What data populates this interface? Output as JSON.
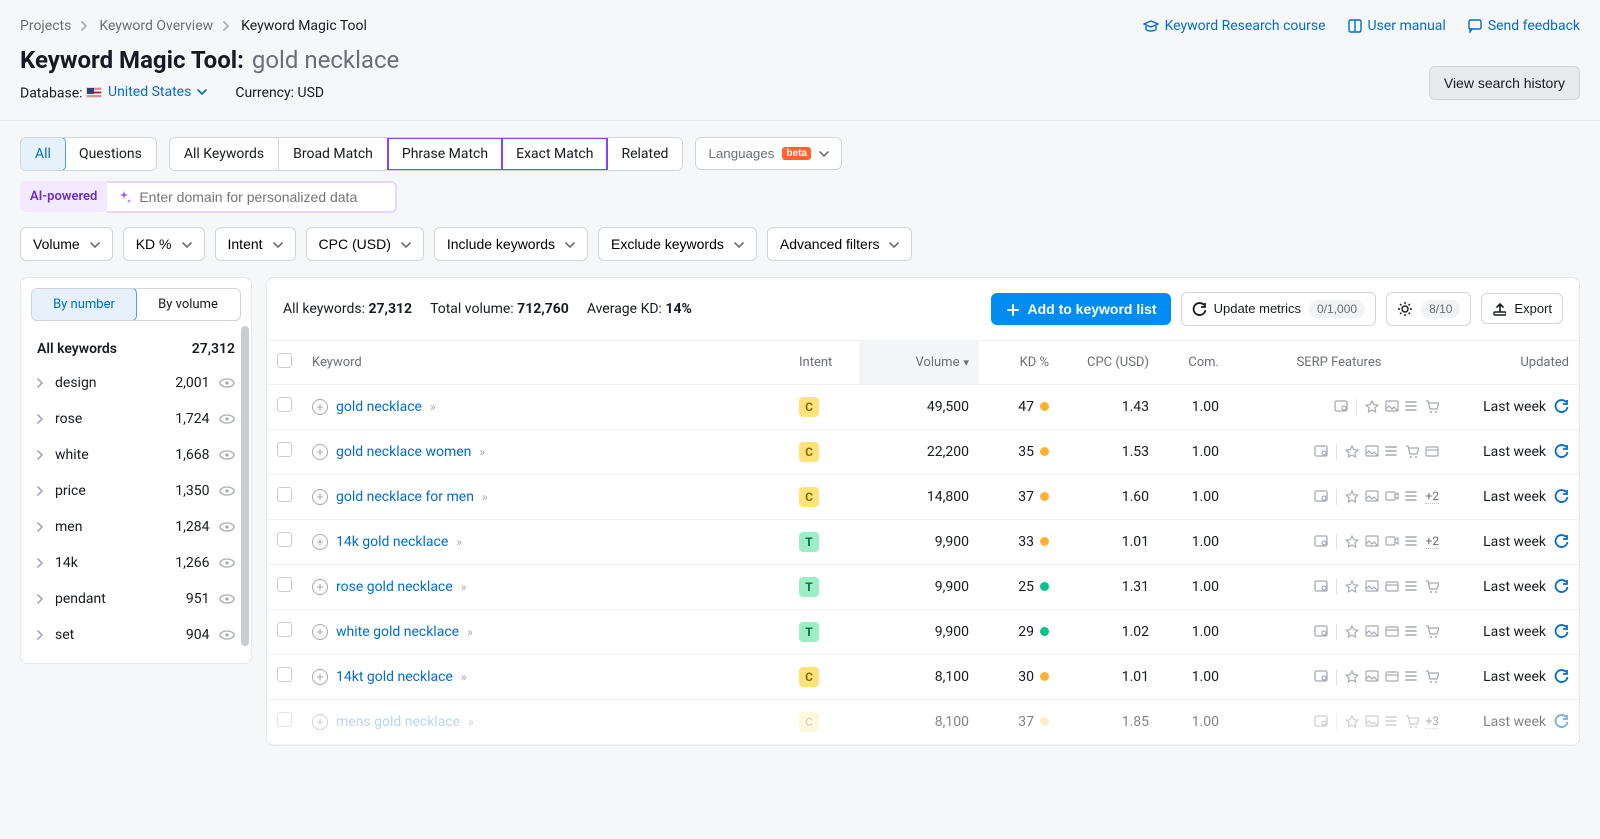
{
  "breadcrumbs": {
    "projects": "Projects",
    "overview": "Keyword Overview",
    "current": "Keyword Magic Tool"
  },
  "header": {
    "title": "Keyword Magic Tool:",
    "query": "gold necklace",
    "database_label": "Database:",
    "country": "United States",
    "currency_label": "Currency:",
    "currency": "USD",
    "links": {
      "course": "Keyword Research course",
      "manual": "User manual",
      "feedback": "Send feedback"
    },
    "history_btn": "View search history"
  },
  "filters1": {
    "seg_a": [
      "All",
      "Questions"
    ],
    "seg_b": [
      "All Keywords",
      "Broad Match",
      "Phrase Match",
      "Exact Match",
      "Related"
    ],
    "languages": "Languages",
    "beta": "beta"
  },
  "ai": {
    "chip": "AI-powered",
    "placeholder": "Enter domain for personalized data"
  },
  "filters2": [
    "Volume",
    "KD %",
    "Intent",
    "CPC (USD)",
    "Include keywords",
    "Exclude keywords",
    "Advanced filters"
  ],
  "sidebar": {
    "toggle": [
      "By number",
      "By volume"
    ],
    "all_label": "All keywords",
    "all_count": "27,312",
    "items": [
      {
        "label": "design",
        "count": "2,001"
      },
      {
        "label": "rose",
        "count": "1,724"
      },
      {
        "label": "white",
        "count": "1,668"
      },
      {
        "label": "price",
        "count": "1,350"
      },
      {
        "label": "men",
        "count": "1,284"
      },
      {
        "label": "14k",
        "count": "1,266"
      },
      {
        "label": "pendant",
        "count": "951"
      },
      {
        "label": "set",
        "count": "904"
      }
    ]
  },
  "stats": {
    "all_label": "All keywords:",
    "all_value": "27,312",
    "vol_label": "Total volume:",
    "vol_value": "712,760",
    "kd_label": "Average KD:",
    "kd_value": "14%"
  },
  "actions": {
    "add": "Add to keyword list",
    "update": "Update metrics",
    "update_badge": "0/1,000",
    "gear_badge": "8/10",
    "export": "Export"
  },
  "columns": {
    "kw": "Keyword",
    "intent": "Intent",
    "volume": "Volume",
    "kd": "KD %",
    "cpc": "CPC (USD)",
    "com": "Com.",
    "serp": "SERP Features",
    "updated": "Updated"
  },
  "rows": [
    {
      "kw": "gold necklace",
      "intent": "C",
      "vol": "49,500",
      "kd": "47",
      "kd_color": "orange",
      "cpc": "1.43",
      "com": "1.00",
      "serp_more": "",
      "updated": "Last week"
    },
    {
      "kw": "gold necklace women",
      "intent": "C",
      "vol": "22,200",
      "kd": "35",
      "kd_color": "orange",
      "cpc": "1.53",
      "com": "1.00",
      "serp_more": "",
      "updated": "Last week"
    },
    {
      "kw": "gold necklace for men",
      "intent": "C",
      "vol": "14,800",
      "kd": "37",
      "kd_color": "orange",
      "cpc": "1.60",
      "com": "1.00",
      "serp_more": "+2",
      "updated": "Last week"
    },
    {
      "kw": "14k gold necklace",
      "intent": "T",
      "vol": "9,900",
      "kd": "33",
      "kd_color": "orange",
      "cpc": "1.01",
      "com": "1.00",
      "serp_more": "+2",
      "updated": "Last week"
    },
    {
      "kw": "rose gold necklace",
      "intent": "T",
      "vol": "9,900",
      "kd": "25",
      "kd_color": "green",
      "cpc": "1.31",
      "com": "1.00",
      "serp_more": "",
      "updated": "Last week"
    },
    {
      "kw": "white gold necklace",
      "intent": "T",
      "vol": "9,900",
      "kd": "29",
      "kd_color": "green",
      "cpc": "1.02",
      "com": "1.00",
      "serp_more": "",
      "updated": "Last week"
    },
    {
      "kw": "14kt gold necklace",
      "intent": "C",
      "vol": "8,100",
      "kd": "30",
      "kd_color": "orange",
      "cpc": "1.01",
      "com": "1.00",
      "serp_more": "",
      "updated": "Last week"
    },
    {
      "kw": "mens gold necklace",
      "intent": "C",
      "vol": "8,100",
      "kd": "37",
      "kd_color": "orange",
      "cpc": "1.85",
      "com": "1.00",
      "serp_more": "+3",
      "updated": "Last week",
      "fade": true
    }
  ]
}
